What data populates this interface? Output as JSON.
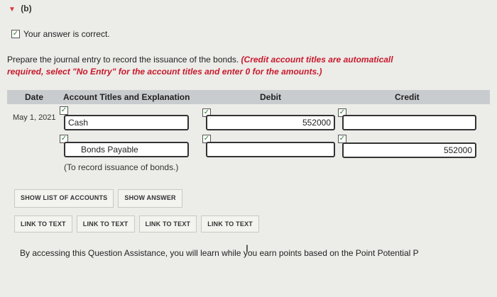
{
  "section": {
    "label": "(b)"
  },
  "status": {
    "message": "Your answer is correct."
  },
  "instructions": {
    "plain": "Prepare the journal entry to record the issuance of the bonds. ",
    "red_line1": "(Credit account titles are automaticall",
    "red_line2": "required, select \"No Entry\" for the account titles and enter 0 for the amounts.)"
  },
  "table": {
    "headers": {
      "date": "Date",
      "account": "Account Titles and Explanation",
      "debit": "Debit",
      "credit": "Credit"
    },
    "rows": [
      {
        "date": "May 1, 2021",
        "account": "Cash",
        "debit": "552000",
        "credit": ""
      },
      {
        "date": "",
        "account": "Bonds Payable",
        "debit": "",
        "credit": "552000"
      }
    ],
    "note": "(To record issuance of bonds.)"
  },
  "buttons": {
    "show_list": "SHOW LIST OF ACCOUNTS",
    "show_answer": "SHOW ANSWER",
    "links": [
      "LINK TO TEXT",
      "LINK TO TEXT",
      "LINK TO TEXT",
      "LINK TO TEXT"
    ]
  },
  "footer": {
    "text": "By accessing this Question Assistance, you will learn while you earn points based on the Point Potential P"
  },
  "icons": {
    "toggle": "triangle-down-icon",
    "check": "checkmark-icon",
    "cursor": "text-cursor-icon"
  },
  "colors": {
    "accent_red": "#c8192a",
    "check_green": "#2a7a2a",
    "header_bg": "#c9cccf"
  }
}
